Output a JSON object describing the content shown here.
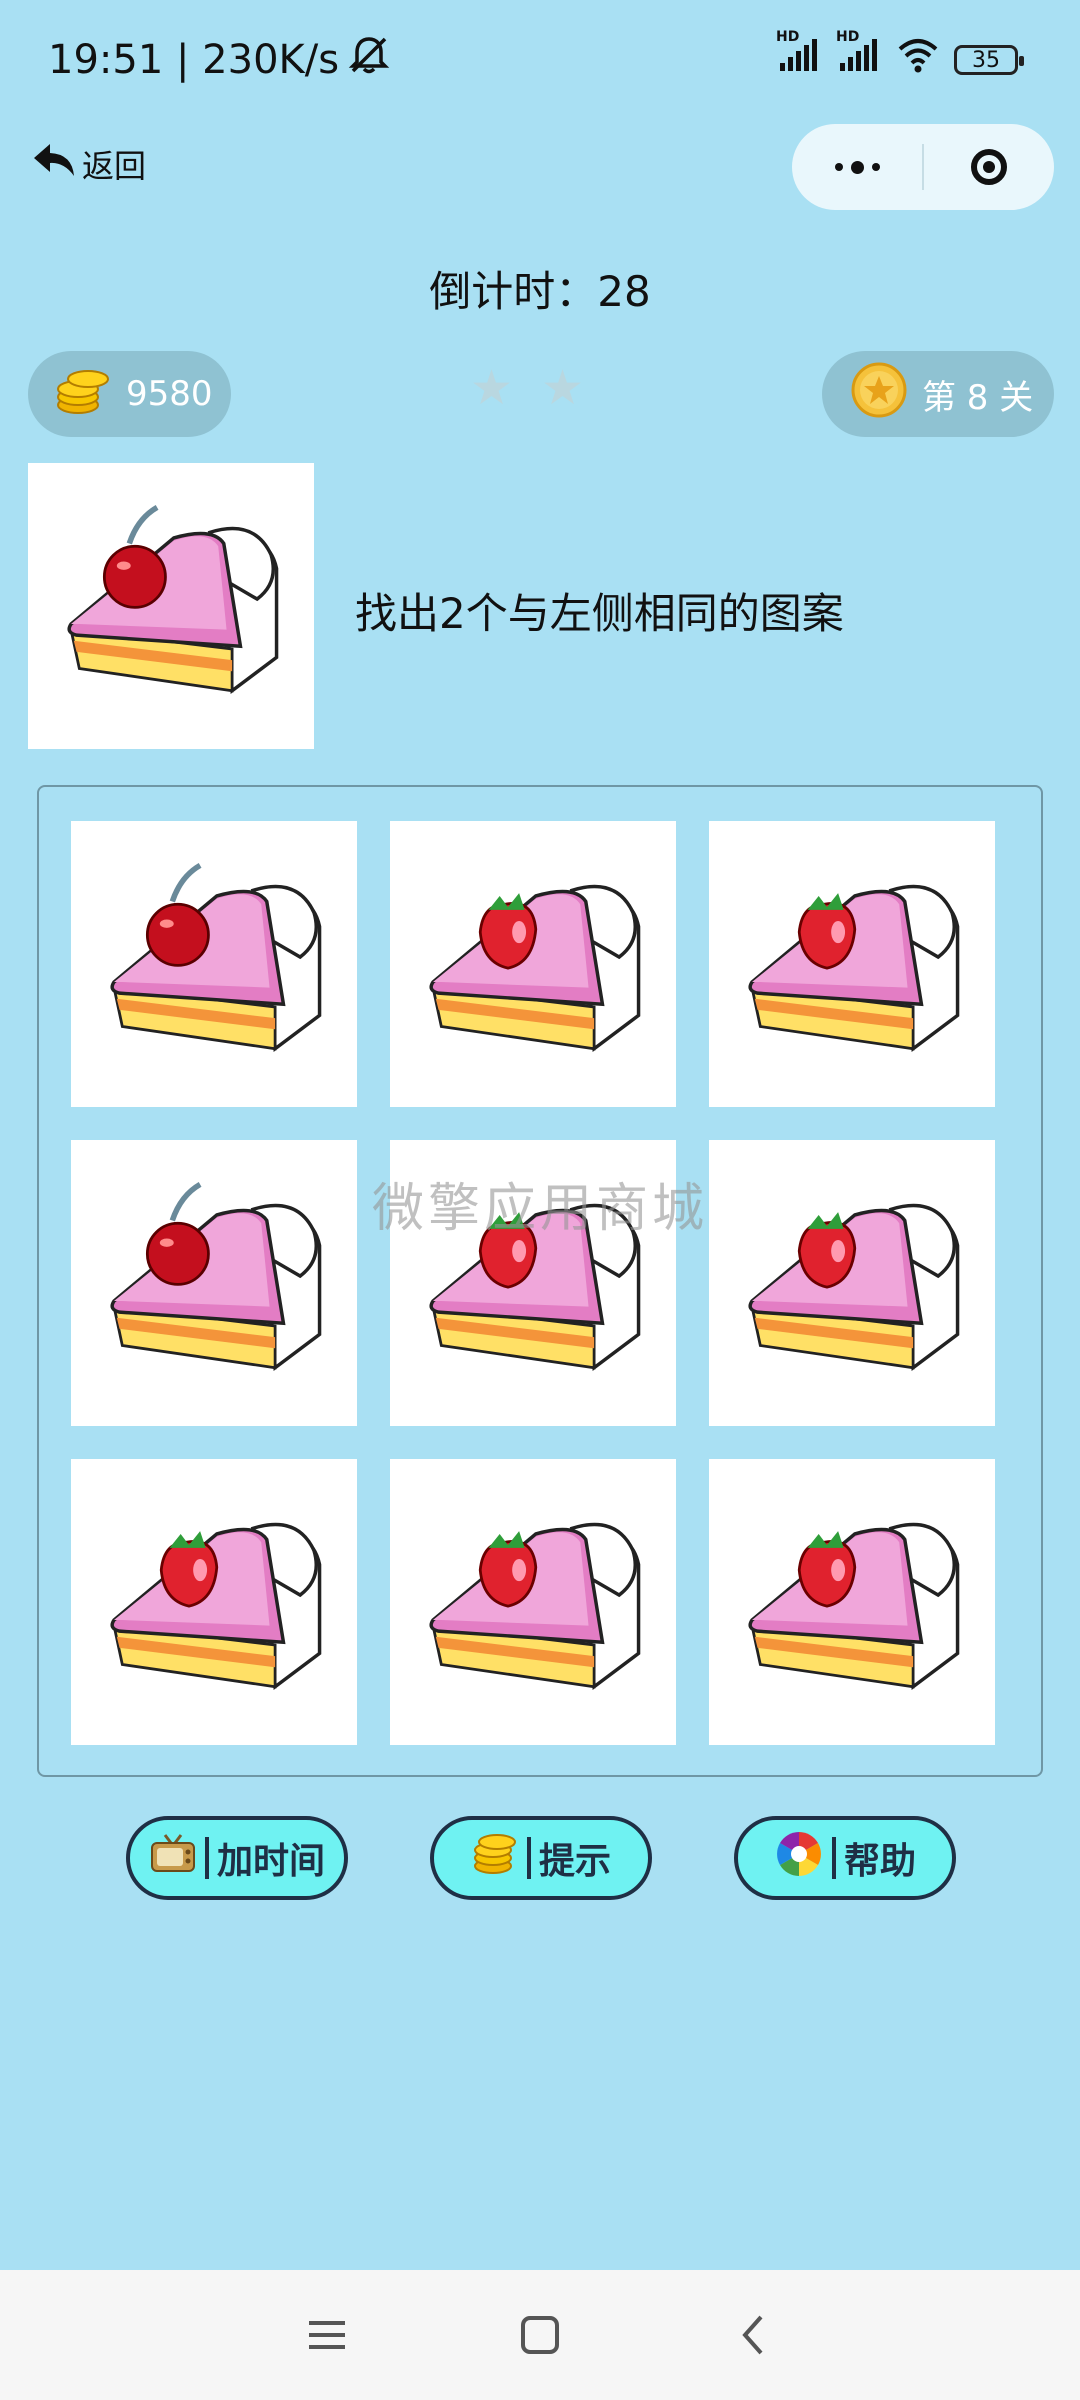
{
  "status_bar": {
    "time_speed": "19:51 | 230K/s",
    "signal1_label": "HD",
    "signal2_label": "HD",
    "battery": "35",
    "icons": [
      "mute-bell-icon",
      "cellular-signal-icon",
      "wifi-icon",
      "battery-icon"
    ]
  },
  "nav": {
    "back_label": "返回",
    "capsule_icons": [
      "more-dots-icon",
      "close-target-icon"
    ]
  },
  "game": {
    "countdown": "倒计时：28",
    "coins": "9580",
    "level": "第 8 关",
    "stars_total": 2,
    "stars_earned": 0,
    "instruction": "找出2个与左侧相同的图案",
    "target": "cherry",
    "tiles": [
      "cherry",
      "strawberry",
      "strawberry",
      "cherry",
      "strawberry",
      "strawberry",
      "strawberry",
      "strawberry",
      "strawberry"
    ],
    "watermark": "微擎应用商城"
  },
  "actions": {
    "add_time": "加时间",
    "hint": "提示",
    "help": "帮助"
  },
  "colors": {
    "background": "#a9e0f3",
    "button_fill": "#6ff2f2",
    "button_border": "#1f2f45",
    "pill": "#8fc2d2"
  }
}
